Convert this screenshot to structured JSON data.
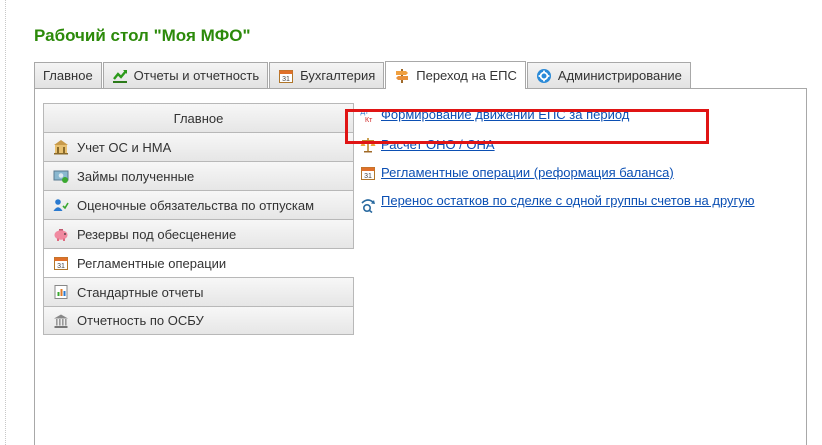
{
  "page": {
    "title": "Рабочий стол \"Моя МФО\""
  },
  "tabs": [
    {
      "label": "Главное",
      "icon": "none",
      "active": false
    },
    {
      "label": "Отчеты и отчетность",
      "icon": "chart-icon",
      "active": false
    },
    {
      "label": "Бухгалтерия",
      "icon": "calendar-icon",
      "active": false
    },
    {
      "label": "Переход на ЕПС",
      "icon": "signpost-icon",
      "active": true
    },
    {
      "label": "Администрирование",
      "icon": "gear-icon",
      "active": false
    }
  ],
  "sections": [
    {
      "label": "Главное",
      "icon": "none"
    },
    {
      "label": "Учет ОС и НМА",
      "icon": "building-icon"
    },
    {
      "label": "Займы полученные",
      "icon": "money-icon"
    },
    {
      "label": "Оценочные обязательства по отпускам",
      "icon": "users-icon"
    },
    {
      "label": "Резервы под обесценение",
      "icon": "piggy-bank-icon"
    },
    {
      "label": "Регламентные операции",
      "icon": "calendar-icon",
      "selected": true
    },
    {
      "label": "Стандартные отчеты",
      "icon": "report-icon"
    },
    {
      "label": "Отчетность по ОСБУ",
      "icon": "bank-icon"
    }
  ],
  "links": [
    {
      "label": "Формирование движений ЕПС за период",
      "icon": "dt-kt-icon"
    },
    {
      "label": "Расчет ОНО / ОНА",
      "icon": "scales-icon"
    },
    {
      "label": "Регламентные операции (реформация баланса)",
      "icon": "calendar-icon"
    },
    {
      "label": "Перенос остатков по сделке с одной группы счетов на другую",
      "icon": "transfer-icon"
    }
  ],
  "colors": {
    "title_green": "#2c8a0a",
    "link_blue": "#0b4fb3",
    "highlight_red": "#e01414"
  }
}
